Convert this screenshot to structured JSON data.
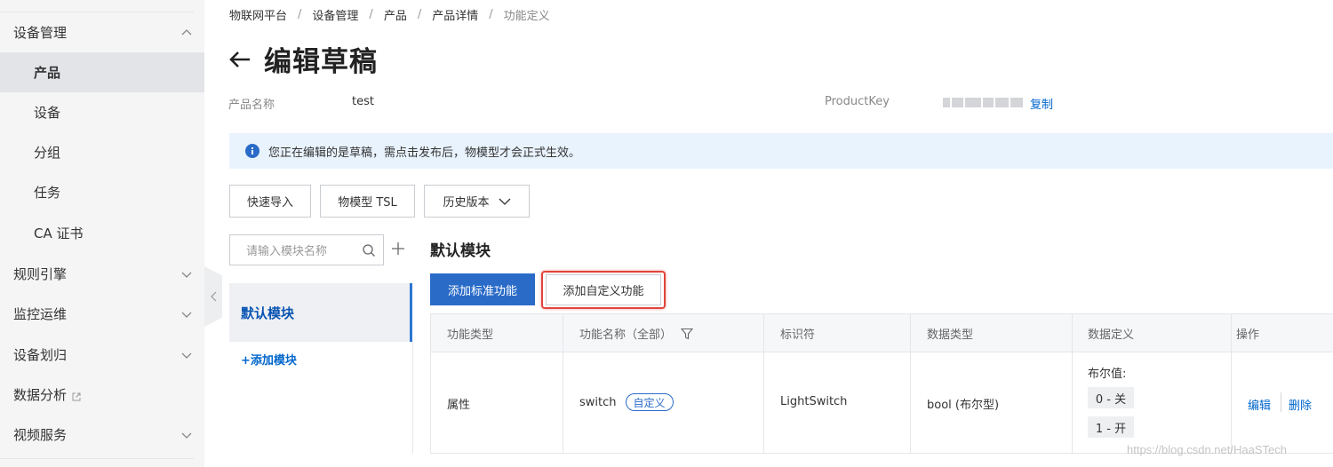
{
  "sidebar": {
    "device_mgmt": "设备管理",
    "items": [
      "产品",
      "设备",
      "分组",
      "任务",
      "CA 证书"
    ],
    "groups": [
      "规则引擎",
      "监控运维",
      "设备划归",
      "数据分析",
      "视频服务"
    ]
  },
  "breadcrumb": [
    "物联网平台",
    "设备管理",
    "产品",
    "产品详情",
    "功能定义"
  ],
  "breadcrumb_sep": "/",
  "title": "编辑草稿",
  "product": {
    "name_label": "产品名称",
    "name_value": "test",
    "key_label": "ProductKey",
    "copy_label": "复制"
  },
  "notice": "您正在编辑的是草稿，需点击发布后，物模型才会正式生效。",
  "toolbar": {
    "quick_import": "快速导入",
    "tsl": "物模型 TSL",
    "history": "历史版本"
  },
  "modules": {
    "search_placeholder": "请输入模块名称",
    "default_module": "默认模块",
    "add_module": "+添加模块"
  },
  "panel": {
    "section_title": "默认模块",
    "add_standard": "添加标准功能",
    "add_custom": "添加自定义功能"
  },
  "table": {
    "headers": [
      "功能类型",
      "功能名称（全部）",
      "标识符",
      "数据类型",
      "数据定义",
      "操作"
    ],
    "row": {
      "type": "属性",
      "name": "switch",
      "tag": "自定义",
      "identifier": "LightSwitch",
      "data_type": "bool (布尔型)",
      "def_title": "布尔值:",
      "def_values": [
        "0 - 关",
        "1 - 开"
      ],
      "edit": "编辑",
      "delete": "删除"
    }
  },
  "watermark": "https://blog.csdn.net/HaaSTech",
  "colors": {
    "primary": "#2a6bc8",
    "link": "#0066cc",
    "highlight_border": "#e0453b",
    "notice_bg": "#e9f3fd",
    "sidebar_bg": "#f5f5f6"
  }
}
